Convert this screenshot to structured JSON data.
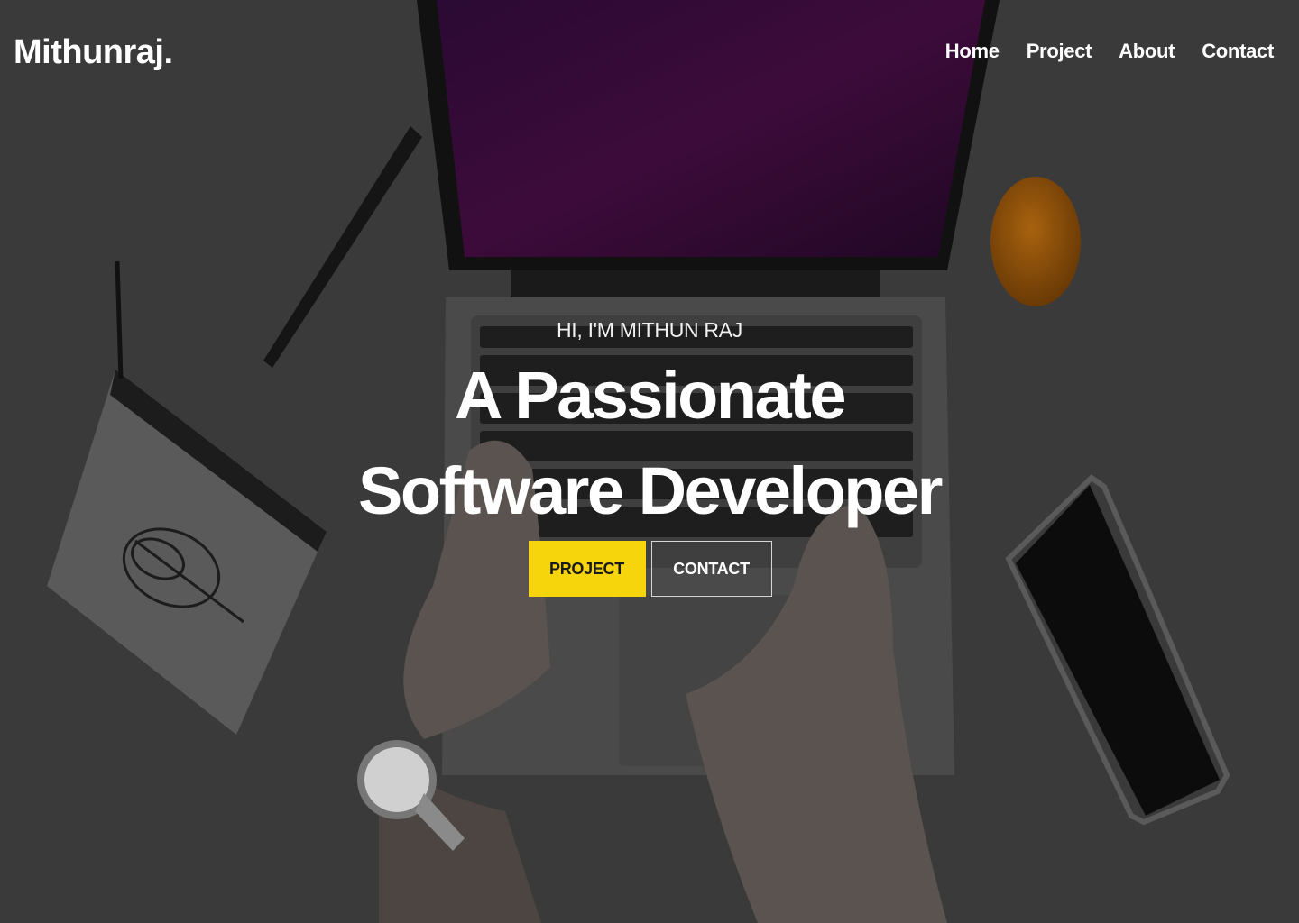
{
  "brand": {
    "logo_text": "Mithunraj."
  },
  "nav": {
    "items": [
      {
        "label": "Home"
      },
      {
        "label": "Project"
      },
      {
        "label": "About"
      },
      {
        "label": "Contact"
      }
    ]
  },
  "hero": {
    "eyebrow": "HI, I'M MITHUN RAJ",
    "headline": "A Passionate Software Developer",
    "buttons": {
      "primary_label": "PROJECT",
      "secondary_label": "CONTACT"
    },
    "background_image": "desk-with-laptop-photo"
  },
  "colors": {
    "accent": "#f7d50d",
    "text": "#ffffff",
    "overlay": "#333333"
  }
}
